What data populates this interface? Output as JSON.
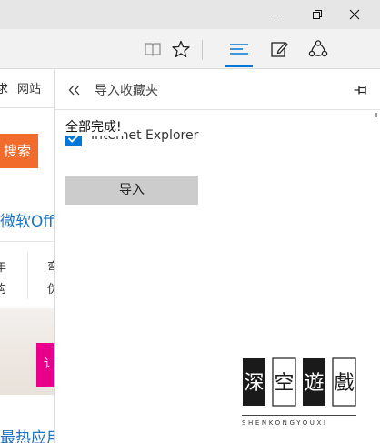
{
  "titlebar": {
    "minimize_icon": "minimize-icon",
    "restore_icon": "restore-icon",
    "close_icon": "close-icon"
  },
  "toolbar": {
    "reading_view_icon": "book-icon",
    "favorite_icon": "star-icon",
    "hub_icon": "hub-lines-icon",
    "note_icon": "pen-note-icon",
    "share_icon": "share-icon",
    "accent_color": "#0078d7"
  },
  "background_page": {
    "nav_items": [
      "求",
      "网站"
    ],
    "search_button": "搜索",
    "title": "微软Offi",
    "cells": [
      "年",
      "弯",
      "购",
      "伪"
    ],
    "banner_text": "讠",
    "bottom_text": "最热应用"
  },
  "panel": {
    "title": "导入收藏夹",
    "import_source_label": "Internet Explorer",
    "import_source_checked": true,
    "status_text": "全部完成!",
    "import_button": "导入"
  },
  "watermark": {
    "logo_characters": "深空遊戲",
    "text": "SHENKONGYOUXI"
  }
}
